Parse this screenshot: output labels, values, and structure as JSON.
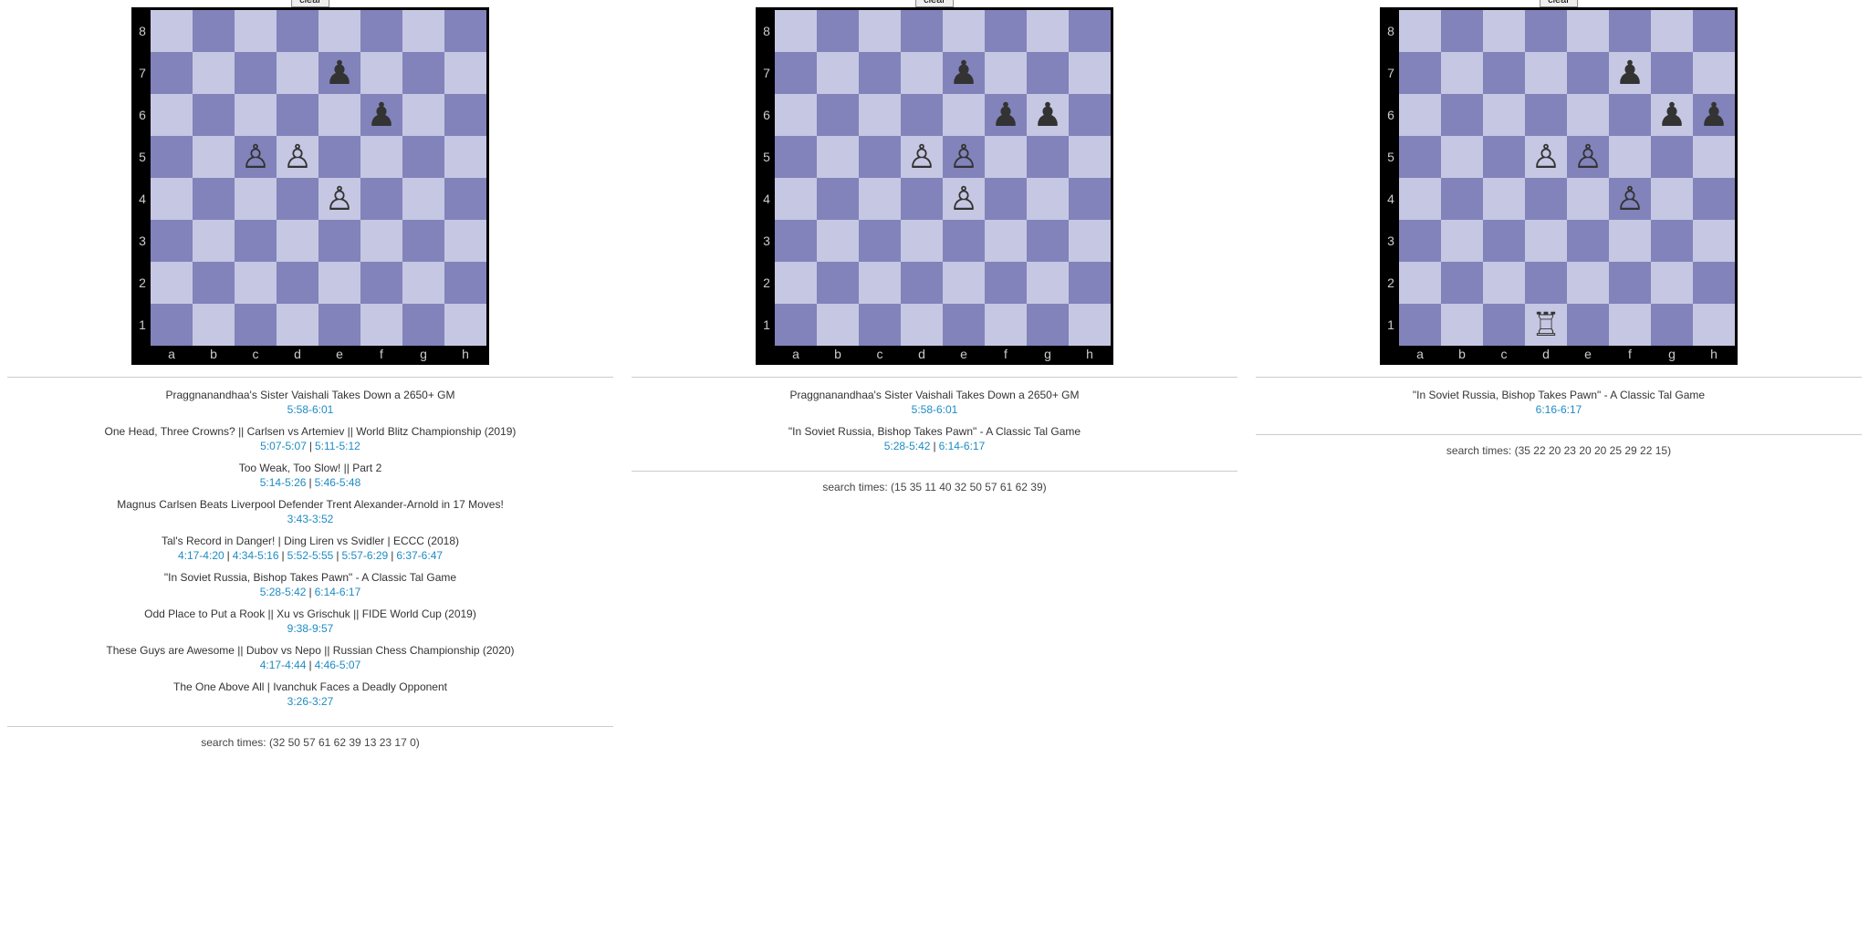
{
  "files": [
    "a",
    "b",
    "c",
    "d",
    "e",
    "f",
    "g",
    "h"
  ],
  "ranks": [
    "8",
    "7",
    "6",
    "5",
    "4",
    "3",
    "2",
    "1"
  ],
  "clear_label": "clear",
  "panels": [
    {
      "pieces": [
        {
          "sq": "e7",
          "glyph": "♟"
        },
        {
          "sq": "f6",
          "glyph": "♟"
        },
        {
          "sq": "c5",
          "glyph": "♙"
        },
        {
          "sq": "d5",
          "glyph": "♙"
        },
        {
          "sq": "e4",
          "glyph": "♙"
        }
      ],
      "results": [
        {
          "title": "Praggnanandhaa's Sister Vaishali Takes Down a 2650+ GM",
          "times": [
            "5:58-6:01"
          ]
        },
        {
          "title": "One Head, Three Crowns? || Carlsen vs Artemiev || World Blitz Championship (2019)",
          "times": [
            "5:07-5:07",
            "5:11-5:12"
          ]
        },
        {
          "title": "Too Weak, Too Slow! || Part 2",
          "times": [
            "5:14-5:26",
            "5:46-5:48"
          ]
        },
        {
          "title": "Magnus Carlsen Beats Liverpool Defender Trent Alexander-Arnold in 17 Moves!",
          "times": [
            "3:43-3:52"
          ]
        },
        {
          "title": "Tal's Record in Danger! | Ding Liren vs Svidler | ECCC (2018)",
          "times": [
            "4:17-4:20",
            "4:34-5:16",
            "5:52-5:55",
            "5:57-6:29",
            "6:37-6:47"
          ]
        },
        {
          "title": "\"In Soviet Russia, Bishop Takes Pawn\" - A Classic Tal Game",
          "times": [
            "5:28-5:42",
            "6:14-6:17"
          ]
        },
        {
          "title": "Odd Place to Put a Rook || Xu vs Grischuk || FIDE World Cup (2019)",
          "times": [
            "9:38-9:57"
          ]
        },
        {
          "title": "These Guys are Awesome || Dubov vs Nepo || Russian Chess Championship (2020)",
          "times": [
            "4:17-4:44",
            "4:46-5:07"
          ]
        },
        {
          "title": "The One Above All | Ivanchuk Faces a Deadly Opponent",
          "times": [
            "3:26-3:27"
          ]
        }
      ],
      "search_times": "search times: (32 50 57 61 62 39 13 23 17 0)"
    },
    {
      "pieces": [
        {
          "sq": "e7",
          "glyph": "♟"
        },
        {
          "sq": "f6",
          "glyph": "♟"
        },
        {
          "sq": "g6",
          "glyph": "♟"
        },
        {
          "sq": "d5",
          "glyph": "♙"
        },
        {
          "sq": "e5",
          "glyph": "♙"
        },
        {
          "sq": "e4",
          "glyph": "♙"
        }
      ],
      "results": [
        {
          "title": "Praggnanandhaa's Sister Vaishali Takes Down a 2650+ GM",
          "times": [
            "5:58-6:01"
          ]
        },
        {
          "title": "\"In Soviet Russia, Bishop Takes Pawn\" - A Classic Tal Game",
          "times": [
            "5:28-5:42",
            "6:14-6:17"
          ]
        }
      ],
      "search_times": "search times: (15 35 11 40 32 50 57 61 62 39)"
    },
    {
      "pieces": [
        {
          "sq": "f7",
          "glyph": "♟"
        },
        {
          "sq": "g6",
          "glyph": "♟"
        },
        {
          "sq": "h6",
          "glyph": "♟"
        },
        {
          "sq": "d5",
          "glyph": "♙"
        },
        {
          "sq": "e5",
          "glyph": "♙"
        },
        {
          "sq": "f4",
          "glyph": "♙"
        },
        {
          "sq": "d1",
          "glyph": "♖"
        }
      ],
      "results": [
        {
          "title": "\"In Soviet Russia, Bishop Takes Pawn\" - A Classic Tal Game",
          "times": [
            "6:16-6:17"
          ]
        }
      ],
      "search_times": "search times: (35 22 20 23 20 20 25 29 22 15)"
    }
  ]
}
